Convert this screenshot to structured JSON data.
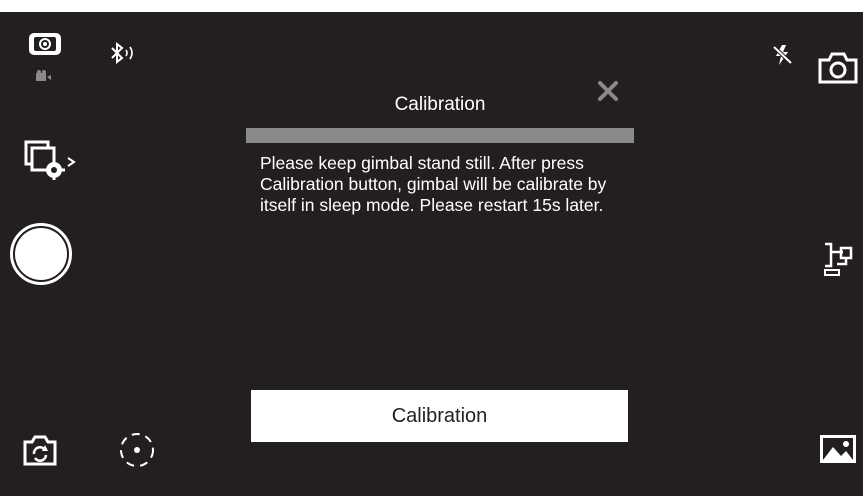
{
  "dialog": {
    "title": "Calibration",
    "progress_percent": 100,
    "message": "Please keep gimbal stand still. After press Calibration button, gimbal will be calibrate by itself in sleep mode. Please restart 15s later.",
    "button_label": "Calibration"
  },
  "icons": {
    "left_top": [
      "photo-mode-icon",
      "video-mode-icon",
      "bluetooth-icon"
    ],
    "left": [
      "settings-icon",
      "shutter-button",
      "switch-camera-icon",
      "focus-target-icon"
    ],
    "right": [
      "flash-off-icon",
      "camera-icon",
      "gimbal-mode-icon",
      "gallery-icon"
    ],
    "close": "close-icon"
  },
  "colors": {
    "background": "#231f20",
    "foreground": "#ffffff",
    "progress": "#8a8a8a",
    "close": "#8a8a8a"
  }
}
